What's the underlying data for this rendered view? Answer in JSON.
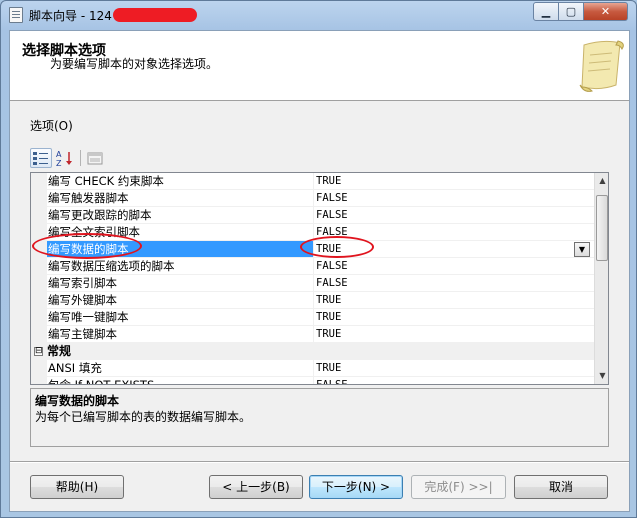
{
  "window": {
    "title": "脚本向导 - 124",
    "controls": {
      "minimize": "▁",
      "maximize": "▢",
      "close": "✕"
    }
  },
  "header": {
    "title": "选择脚本选项",
    "subtitle": "为要编写脚本的对象选择选项。",
    "icon": "scroll-icon"
  },
  "options": {
    "label": "选项(O)",
    "toolbar": {
      "categorized": "categorized-icon",
      "alphabetical": "sort-az-icon",
      "pages": "property-pages-icon"
    },
    "rows": [
      {
        "name": "编写 CHECK 约束脚本",
        "value": "TRUE"
      },
      {
        "name": "编写触发器脚本",
        "value": "FALSE"
      },
      {
        "name": "编写更改跟踪的脚本",
        "value": "FALSE"
      },
      {
        "name": "编写全文索引脚本",
        "value": "FALSE"
      },
      {
        "name": "编写数据的脚本",
        "value": "TRUE",
        "selected": true
      },
      {
        "name": "编写数据压缩选项的脚本",
        "value": "FALSE"
      },
      {
        "name": "编写索引脚本",
        "value": "FALSE"
      },
      {
        "name": "编写外键脚本",
        "value": "TRUE"
      },
      {
        "name": "编写唯一键脚本",
        "value": "TRUE"
      },
      {
        "name": "编写主键脚本",
        "value": "TRUE"
      }
    ],
    "category": {
      "toggle": "⊟",
      "label": "常规"
    },
    "category_rows": [
      {
        "name": "ANSI 填充",
        "value": "TRUE"
      },
      {
        "name": "包含 If NOT EXISTS",
        "value": "FALSE"
      }
    ],
    "dropdown_arrow": "▼",
    "scroll_up": "▲",
    "scroll_down": "▼"
  },
  "description": {
    "title": "编写数据的脚本",
    "text": "为每个已编写脚本的表的数据编写脚本。"
  },
  "buttons": {
    "help": "帮助(H)",
    "prev": "< 上一步(B)",
    "next": "下一步(N) >",
    "finish": "完成(F) >>|",
    "cancel": "取消"
  },
  "colors": {
    "selection": "#3399ff",
    "annotation": "#e0141e",
    "redaction": "#ee1c24"
  }
}
